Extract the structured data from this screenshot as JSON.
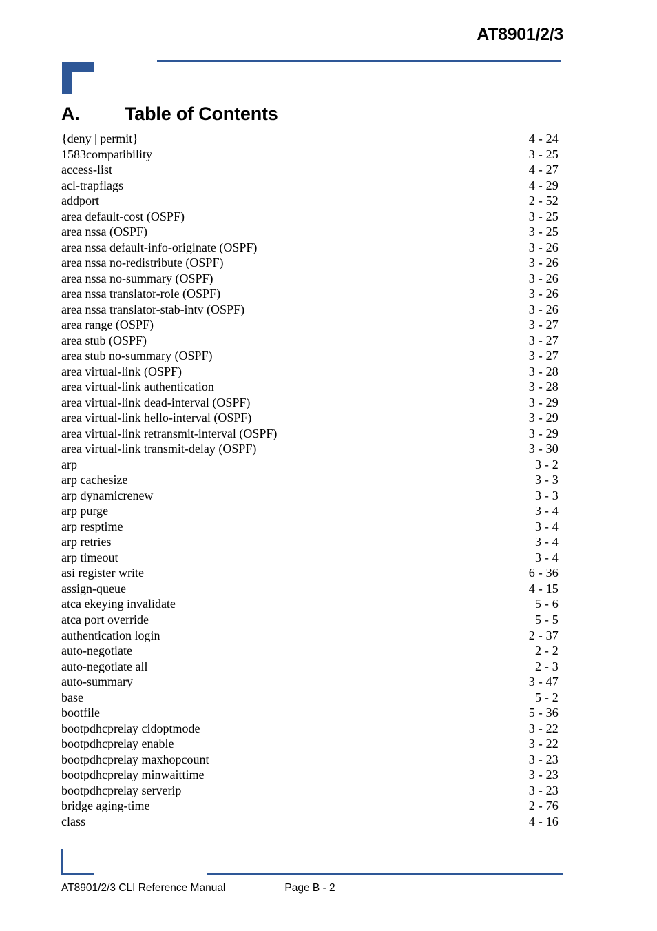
{
  "header": {
    "doc_title": "AT8901/2/3"
  },
  "section": {
    "letter": "A.",
    "title": "Table of Contents"
  },
  "colors": {
    "accent_blue": "#2E5797",
    "text": "#000000",
    "background": "#FFFFFF"
  },
  "toc": {
    "entries": [
      {
        "name": "{deny | permit}",
        "page": "4 - 24"
      },
      {
        "name": "1583compatibility",
        "page": "3 - 25"
      },
      {
        "name": "access-list",
        "page": "4 - 27"
      },
      {
        "name": "acl-trapflags",
        "page": "4 - 29"
      },
      {
        "name": "addport",
        "page": "2 - 52"
      },
      {
        "name": "area default-cost (OSPF)",
        "page": "3 - 25"
      },
      {
        "name": "area nssa (OSPF)",
        "page": "3 - 25"
      },
      {
        "name": "area nssa default-info-originate (OSPF)",
        "page": "3 - 26"
      },
      {
        "name": "area nssa no-redistribute (OSPF)",
        "page": "3 - 26"
      },
      {
        "name": "area nssa no-summary (OSPF)",
        "page": "3 - 26"
      },
      {
        "name": "area nssa translator-role (OSPF)",
        "page": "3 - 26"
      },
      {
        "name": "area nssa translator-stab-intv (OSPF)",
        "page": "3 - 26"
      },
      {
        "name": "area range (OSPF)",
        "page": "3 - 27"
      },
      {
        "name": "area stub (OSPF)",
        "page": "3 - 27"
      },
      {
        "name": "area stub no-summary (OSPF)",
        "page": "3 - 27"
      },
      {
        "name": "area virtual-link (OSPF)",
        "page": "3 - 28"
      },
      {
        "name": "area virtual-link authentication",
        "page": "3 - 28"
      },
      {
        "name": "area virtual-link dead-interval (OSPF)",
        "page": "3 - 29"
      },
      {
        "name": "area virtual-link hello-interval (OSPF)",
        "page": "3 - 29"
      },
      {
        "name": "area virtual-link retransmit-interval (OSPF)",
        "page": "3 - 29"
      },
      {
        "name": "area virtual-link transmit-delay (OSPF)",
        "page": "3 - 30"
      },
      {
        "name": "arp",
        "page": "3 - 2"
      },
      {
        "name": "arp cachesize",
        "page": "3 - 3"
      },
      {
        "name": "arp dynamicrenew",
        "page": "3 - 3"
      },
      {
        "name": "arp purge",
        "page": "3 - 4"
      },
      {
        "name": "arp resptime",
        "page": "3 - 4"
      },
      {
        "name": "arp retries",
        "page": "3 - 4"
      },
      {
        "name": "arp timeout",
        "page": "3 - 4"
      },
      {
        "name": "asi register write",
        "page": "6 - 36"
      },
      {
        "name": "assign-queue",
        "page": "4 - 15"
      },
      {
        "name": "atca ekeying invalidate",
        "page": "5 - 6"
      },
      {
        "name": "atca port override",
        "page": "5 - 5"
      },
      {
        "name": "authentication login",
        "page": "2 - 37"
      },
      {
        "name": "auto-negotiate",
        "page": "2 - 2"
      },
      {
        "name": "auto-negotiate all",
        "page": "2 - 3"
      },
      {
        "name": "auto-summary",
        "page": "3 - 47"
      },
      {
        "name": "base",
        "page": "5 - 2"
      },
      {
        "name": "bootfile",
        "page": "5 - 36"
      },
      {
        "name": "bootpdhcprelay cidoptmode",
        "page": "3 - 22"
      },
      {
        "name": "bootpdhcprelay enable",
        "page": "3 - 22"
      },
      {
        "name": "bootpdhcprelay maxhopcount",
        "page": "3 - 23"
      },
      {
        "name": "bootpdhcprelay minwaittime",
        "page": "3 - 23"
      },
      {
        "name": "bootpdhcprelay serverip",
        "page": "3 - 23"
      },
      {
        "name": "bridge aging-time",
        "page": "2 - 76"
      },
      {
        "name": "class",
        "page": "4 - 16"
      }
    ]
  },
  "footer": {
    "manual": "AT8901/2/3 CLI Reference Manual",
    "page_label": "Page B - 2"
  }
}
